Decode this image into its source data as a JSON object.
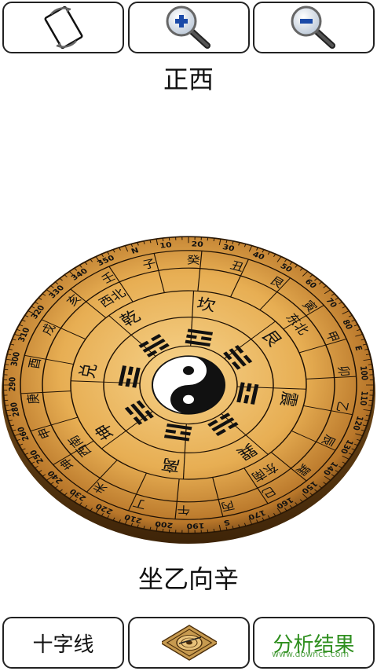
{
  "toolbar": {
    "rotate_icon": "rotate-icon",
    "zoom_in_icon": "zoom-in-icon",
    "zoom_out_icon": "zoom-out-icon"
  },
  "direction": {
    "label": "正西"
  },
  "compass": {
    "ring_trigrams_outer": [
      "兑",
      "乾",
      "坎",
      "艮",
      "震",
      "巽",
      "离",
      "坤"
    ],
    "ring_gua": [
      "酉",
      "戌",
      "亥",
      "壬",
      "子",
      "癸",
      "丑",
      "艮",
      "寅",
      "甲",
      "卯",
      "乙",
      "辰",
      "巽",
      "巳",
      "丙",
      "午",
      "丁",
      "未",
      "坤",
      "申",
      "庚"
    ],
    "ring_mid": [
      "西北",
      "东北",
      "东南",
      "西南"
    ],
    "degree_labels": [
      "280",
      "290",
      "300",
      "310",
      "320",
      "330",
      "340",
      "350",
      "N",
      "10",
      "20",
      "30",
      "40",
      "50",
      "60",
      "70",
      "80",
      "E",
      "100",
      "110",
      "120",
      "130",
      "140",
      "150",
      "160",
      "170",
      "S",
      "190",
      "200",
      "210",
      "220",
      "230",
      "240",
      "250",
      "260"
    ],
    "colors": {
      "dial_light": "#f3c877",
      "dial_mid": "#d99a3c",
      "dial_dark": "#5a3510"
    }
  },
  "result": {
    "text": "坐乙向辛"
  },
  "bottom_bar": {
    "crosshair_label": "十字线",
    "compass_image_icon": "luopan-icon",
    "analysis_label": "分析结果"
  },
  "watermark": {
    "text": "www.downcc.com"
  }
}
